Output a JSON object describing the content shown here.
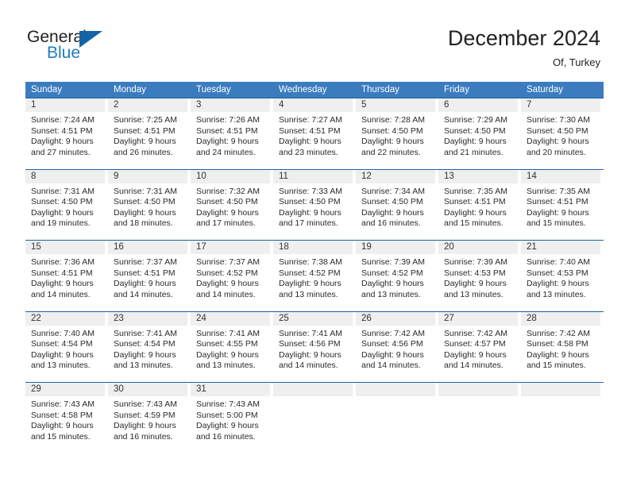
{
  "logo": {
    "line1": "General",
    "line2": "Blue",
    "triangle_icon": "triangle-icon",
    "color_dark": "#231f20",
    "color_blue": "#1f7dc0"
  },
  "header": {
    "title": "December 2024",
    "subtitle": "Of, Turkey"
  },
  "theme": {
    "header_blue": "#3b7cbf",
    "row_border_blue": "#1e63a8",
    "day_band_gray": "#efefef"
  },
  "weekdays": [
    "Sunday",
    "Monday",
    "Tuesday",
    "Wednesday",
    "Thursday",
    "Friday",
    "Saturday"
  ],
  "weeks": [
    [
      {
        "day": "1",
        "sunrise": "Sunrise: 7:24 AM",
        "sunset": "Sunset: 4:51 PM",
        "daylight1": "Daylight: 9 hours",
        "daylight2": "and 27 minutes."
      },
      {
        "day": "2",
        "sunrise": "Sunrise: 7:25 AM",
        "sunset": "Sunset: 4:51 PM",
        "daylight1": "Daylight: 9 hours",
        "daylight2": "and 26 minutes."
      },
      {
        "day": "3",
        "sunrise": "Sunrise: 7:26 AM",
        "sunset": "Sunset: 4:51 PM",
        "daylight1": "Daylight: 9 hours",
        "daylight2": "and 24 minutes."
      },
      {
        "day": "4",
        "sunrise": "Sunrise: 7:27 AM",
        "sunset": "Sunset: 4:51 PM",
        "daylight1": "Daylight: 9 hours",
        "daylight2": "and 23 minutes."
      },
      {
        "day": "5",
        "sunrise": "Sunrise: 7:28 AM",
        "sunset": "Sunset: 4:50 PM",
        "daylight1": "Daylight: 9 hours",
        "daylight2": "and 22 minutes."
      },
      {
        "day": "6",
        "sunrise": "Sunrise: 7:29 AM",
        "sunset": "Sunset: 4:50 PM",
        "daylight1": "Daylight: 9 hours",
        "daylight2": "and 21 minutes."
      },
      {
        "day": "7",
        "sunrise": "Sunrise: 7:30 AM",
        "sunset": "Sunset: 4:50 PM",
        "daylight1": "Daylight: 9 hours",
        "daylight2": "and 20 minutes."
      }
    ],
    [
      {
        "day": "8",
        "sunrise": "Sunrise: 7:31 AM",
        "sunset": "Sunset: 4:50 PM",
        "daylight1": "Daylight: 9 hours",
        "daylight2": "and 19 minutes."
      },
      {
        "day": "9",
        "sunrise": "Sunrise: 7:31 AM",
        "sunset": "Sunset: 4:50 PM",
        "daylight1": "Daylight: 9 hours",
        "daylight2": "and 18 minutes."
      },
      {
        "day": "10",
        "sunrise": "Sunrise: 7:32 AM",
        "sunset": "Sunset: 4:50 PM",
        "daylight1": "Daylight: 9 hours",
        "daylight2": "and 17 minutes."
      },
      {
        "day": "11",
        "sunrise": "Sunrise: 7:33 AM",
        "sunset": "Sunset: 4:50 PM",
        "daylight1": "Daylight: 9 hours",
        "daylight2": "and 17 minutes."
      },
      {
        "day": "12",
        "sunrise": "Sunrise: 7:34 AM",
        "sunset": "Sunset: 4:50 PM",
        "daylight1": "Daylight: 9 hours",
        "daylight2": "and 16 minutes."
      },
      {
        "day": "13",
        "sunrise": "Sunrise: 7:35 AM",
        "sunset": "Sunset: 4:51 PM",
        "daylight1": "Daylight: 9 hours",
        "daylight2": "and 15 minutes."
      },
      {
        "day": "14",
        "sunrise": "Sunrise: 7:35 AM",
        "sunset": "Sunset: 4:51 PM",
        "daylight1": "Daylight: 9 hours",
        "daylight2": "and 15 minutes."
      }
    ],
    [
      {
        "day": "15",
        "sunrise": "Sunrise: 7:36 AM",
        "sunset": "Sunset: 4:51 PM",
        "daylight1": "Daylight: 9 hours",
        "daylight2": "and 14 minutes."
      },
      {
        "day": "16",
        "sunrise": "Sunrise: 7:37 AM",
        "sunset": "Sunset: 4:51 PM",
        "daylight1": "Daylight: 9 hours",
        "daylight2": "and 14 minutes."
      },
      {
        "day": "17",
        "sunrise": "Sunrise: 7:37 AM",
        "sunset": "Sunset: 4:52 PM",
        "daylight1": "Daylight: 9 hours",
        "daylight2": "and 14 minutes."
      },
      {
        "day": "18",
        "sunrise": "Sunrise: 7:38 AM",
        "sunset": "Sunset: 4:52 PM",
        "daylight1": "Daylight: 9 hours",
        "daylight2": "and 13 minutes."
      },
      {
        "day": "19",
        "sunrise": "Sunrise: 7:39 AM",
        "sunset": "Sunset: 4:52 PM",
        "daylight1": "Daylight: 9 hours",
        "daylight2": "and 13 minutes."
      },
      {
        "day": "20",
        "sunrise": "Sunrise: 7:39 AM",
        "sunset": "Sunset: 4:53 PM",
        "daylight1": "Daylight: 9 hours",
        "daylight2": "and 13 minutes."
      },
      {
        "day": "21",
        "sunrise": "Sunrise: 7:40 AM",
        "sunset": "Sunset: 4:53 PM",
        "daylight1": "Daylight: 9 hours",
        "daylight2": "and 13 minutes."
      }
    ],
    [
      {
        "day": "22",
        "sunrise": "Sunrise: 7:40 AM",
        "sunset": "Sunset: 4:54 PM",
        "daylight1": "Daylight: 9 hours",
        "daylight2": "and 13 minutes."
      },
      {
        "day": "23",
        "sunrise": "Sunrise: 7:41 AM",
        "sunset": "Sunset: 4:54 PM",
        "daylight1": "Daylight: 9 hours",
        "daylight2": "and 13 minutes."
      },
      {
        "day": "24",
        "sunrise": "Sunrise: 7:41 AM",
        "sunset": "Sunset: 4:55 PM",
        "daylight1": "Daylight: 9 hours",
        "daylight2": "and 13 minutes."
      },
      {
        "day": "25",
        "sunrise": "Sunrise: 7:41 AM",
        "sunset": "Sunset: 4:56 PM",
        "daylight1": "Daylight: 9 hours",
        "daylight2": "and 14 minutes."
      },
      {
        "day": "26",
        "sunrise": "Sunrise: 7:42 AM",
        "sunset": "Sunset: 4:56 PM",
        "daylight1": "Daylight: 9 hours",
        "daylight2": "and 14 minutes."
      },
      {
        "day": "27",
        "sunrise": "Sunrise: 7:42 AM",
        "sunset": "Sunset: 4:57 PM",
        "daylight1": "Daylight: 9 hours",
        "daylight2": "and 14 minutes."
      },
      {
        "day": "28",
        "sunrise": "Sunrise: 7:42 AM",
        "sunset": "Sunset: 4:58 PM",
        "daylight1": "Daylight: 9 hours",
        "daylight2": "and 15 minutes."
      }
    ],
    [
      {
        "day": "29",
        "sunrise": "Sunrise: 7:43 AM",
        "sunset": "Sunset: 4:58 PM",
        "daylight1": "Daylight: 9 hours",
        "daylight2": "and 15 minutes."
      },
      {
        "day": "30",
        "sunrise": "Sunrise: 7:43 AM",
        "sunset": "Sunset: 4:59 PM",
        "daylight1": "Daylight: 9 hours",
        "daylight2": "and 16 minutes."
      },
      {
        "day": "31",
        "sunrise": "Sunrise: 7:43 AM",
        "sunset": "Sunset: 5:00 PM",
        "daylight1": "Daylight: 9 hours",
        "daylight2": "and 16 minutes."
      },
      {
        "day": "",
        "sunrise": "",
        "sunset": "",
        "daylight1": "",
        "daylight2": ""
      },
      {
        "day": "",
        "sunrise": "",
        "sunset": "",
        "daylight1": "",
        "daylight2": ""
      },
      {
        "day": "",
        "sunrise": "",
        "sunset": "",
        "daylight1": "",
        "daylight2": ""
      },
      {
        "day": "",
        "sunrise": "",
        "sunset": "",
        "daylight1": "",
        "daylight2": ""
      }
    ]
  ]
}
